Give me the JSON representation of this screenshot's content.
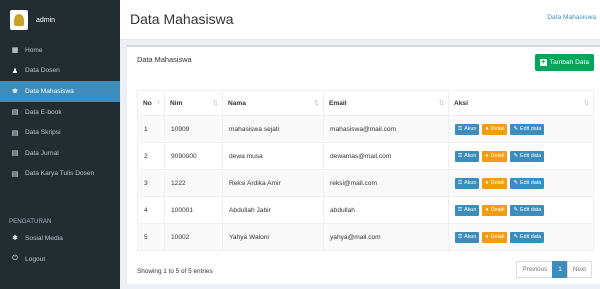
{
  "sidebar": {
    "username": "admin",
    "items": [
      {
        "label": "Home",
        "icon": "dashboard-icon",
        "glyph": "▦",
        "active": false
      },
      {
        "label": "Data Dosen",
        "icon": "user-icon",
        "glyph": "♟",
        "active": false
      },
      {
        "label": "Data Mahasiswa",
        "icon": "users-icon",
        "glyph": "♚",
        "active": true
      },
      {
        "label": "Data E-book",
        "icon": "book-icon",
        "glyph": "▤",
        "active": false
      },
      {
        "label": "Data Skripsi",
        "icon": "book-icon",
        "glyph": "▤",
        "active": false
      },
      {
        "label": "Data Jurnal",
        "icon": "book-icon",
        "glyph": "▤",
        "active": false
      },
      {
        "label": "Data Karya Tulis Dosen",
        "icon": "book-icon",
        "glyph": "▤",
        "active": false
      }
    ],
    "section_header": "PENGATURAN",
    "settings": [
      {
        "label": "Sosial Media",
        "icon": "gear-icon",
        "glyph": "✱"
      },
      {
        "label": "Logout",
        "icon": "power-icon",
        "glyph": "⏻"
      }
    ]
  },
  "header": {
    "title": "Data Mahasiswa",
    "breadcrumb": "Data Mahasiswa"
  },
  "box": {
    "title": "Data Mahasiswa",
    "add_button": "Tambah Data"
  },
  "table": {
    "columns": [
      "No",
      "Nim",
      "Nama",
      "Email",
      "Aksi"
    ],
    "rows": [
      {
        "no": "1",
        "nim": "10909",
        "nama": "mahasiswa sejati",
        "email": "mahasiswa@mail.com"
      },
      {
        "no": "2",
        "nim": "9090000",
        "nama": "dewa musa",
        "email": "dewamas@mail.com"
      },
      {
        "no": "3",
        "nim": "1222",
        "nama": "Reksi Ardika Amir",
        "email": "reksi@mail.com"
      },
      {
        "no": "4",
        "nim": "100001",
        "nama": "Abdullah Jabir",
        "email": "abdullah"
      },
      {
        "no": "5",
        "nim": "10002",
        "nama": "Yahya Waloni",
        "email": "yahya@mail.com"
      }
    ],
    "actions": {
      "akun": "Akun",
      "detail": "Detail",
      "edit": "Edit data"
    }
  },
  "footer": {
    "info": "Showing 1 to 5 of 5 entries",
    "previous": "Previous",
    "page": "1",
    "next": "Next"
  },
  "colors": {
    "sidebar": "#222d32",
    "active": "#3c8dbc",
    "success": "#00a65a",
    "warning": "#f39c12"
  }
}
